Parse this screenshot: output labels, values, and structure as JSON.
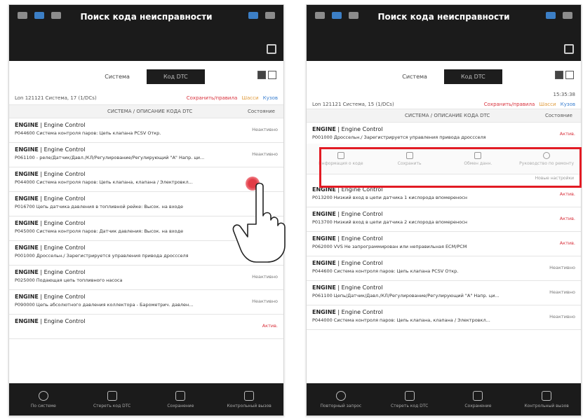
{
  "colors": {
    "accent_red": "#e21b24",
    "status_active": "#d8303b",
    "status_inactive": "#777777",
    "bar_bg": "#1b1b1b"
  },
  "left": {
    "title": "Поиск кода неисправности",
    "segments": [
      "Система",
      "Код DTC"
    ],
    "summary": "Lon 121121 Система, 17 (1/DCs)",
    "links": [
      "Сохранить/правила",
      "Шасси",
      "Кузов"
    ],
    "col_head": {
      "system": "СИСТЕМА / ОПИСАНИЕ КОДА DTC",
      "status": "Состояние"
    },
    "items": [
      {
        "sys": "ENGINE",
        "sub": " | Engine Control",
        "desc": "P044600 Система контроля паров: Цепь клапана PCSV Откр.",
        "status": "Неактивно",
        "active": false
      },
      {
        "sys": "ENGINE",
        "sub": " | Engine Control",
        "desc": "P061100 - реле/Датчик/Давл./КЛ/Регулирование/Регулирующий \"А\" Напр. ци...",
        "status": "Неактивно",
        "active": false
      },
      {
        "sys": "ENGINE",
        "sub": " | Engine Control",
        "desc": "P044000 Система контроля паров: Цепь клапана, клапана / Электровкл...",
        "status": "",
        "active": false
      },
      {
        "sys": "ENGINE",
        "sub": " | Engine Control",
        "desc": "P016700 Цепь датчика давления в топливной рейке: Высок. на входе",
        "status": "",
        "active": false
      },
      {
        "sys": "ENGINE",
        "sub": " | Engine Control",
        "desc": "P045000 Система контроля паров: Датчик давления: Высок. на входе",
        "status": "",
        "active": false
      },
      {
        "sys": "ENGINE",
        "sub": " | Engine Control",
        "desc": "P001000 Дроссельн./ Зарегистрируется управления привода дроссселя",
        "status": "Актив.",
        "active": true
      },
      {
        "sys": "ENGINE",
        "sub": " | Engine Control",
        "desc": "P025000 Подающая цепь топливного насоса",
        "status": "Неактивно",
        "active": false
      },
      {
        "sys": "ENGINE",
        "sub": " | Engine Control",
        "desc": "P090000 Цепь абсолютного давления коллектора - Барометрич. давлен...",
        "status": "Неактивно",
        "active": false
      },
      {
        "sys": "ENGINE",
        "sub": " | Engine Control",
        "desc": "",
        "status": "Актив.",
        "active": true
      }
    ],
    "bottom": [
      "По системе",
      "Стереть код DTC",
      "Сохранение",
      "Контрольный вызов"
    ]
  },
  "right": {
    "title": "Поиск кода неисправности",
    "segments": [
      "Система",
      "Код DTC"
    ],
    "time": "15:35:38",
    "summary": "Lon 121121 Система, 15 (1/DCs)",
    "links": [
      "Сохранить/правила",
      "Шасси",
      "Кузов"
    ],
    "col_head": {
      "system": "СИСТЕМА / ОПИСАНИЕ КОДА DTC",
      "status": "Состояние"
    },
    "selected": {
      "sys": "ENGINE",
      "sub": " | Engine Control",
      "desc": "P001000 Дроссельн./ Зарегистрируется управления привода дроссселя",
      "status": "Актив.",
      "active": true
    },
    "actions": [
      "Информация о коде",
      "Сохранить",
      "Обмен данн.",
      "Руководство по ремонту"
    ],
    "action_note": "Новые настройки",
    "items": [
      {
        "sys": "ENGINE",
        "sub": " | Engine Control",
        "desc": "P013200 Низкий вход в цепи датчика 1 кислорода впомереносн",
        "status": "Актив.",
        "active": true
      },
      {
        "sys": "ENGINE",
        "sub": " | Engine Control",
        "desc": "P013700 Низкий вход в цепи датчика 2 кислорода впомереносн",
        "status": "Актив.",
        "active": true
      },
      {
        "sys": "ENGINE",
        "sub": " | Engine Control",
        "desc": "P062000 VVS Не запрограммирован или неправильная ECM/PCM",
        "status": "Актив.",
        "active": true
      },
      {
        "sys": "ENGINE",
        "sub": " | Engine Control",
        "desc": "P044600 Система контроля паров: Цепь клапана PCSV Откр.",
        "status": "Неактивно",
        "active": false
      },
      {
        "sys": "ENGINE",
        "sub": " | Engine Control",
        "desc": "P061100 Цепь/Датчик/Давл./КЛ/Регулирование/Регулирующий \"А\" Напр. ци...",
        "status": "Неактивно",
        "active": false
      },
      {
        "sys": "ENGINE",
        "sub": " | Engine Control",
        "desc": "P044000 Система контроля паров: Цепь клапана, клапана / Электровкл...",
        "status": "Неактивно",
        "active": false
      }
    ],
    "bottom": [
      "Повторный запрос",
      "Стереть код DTC",
      "Сохранение",
      "Контрольный вызов"
    ]
  }
}
